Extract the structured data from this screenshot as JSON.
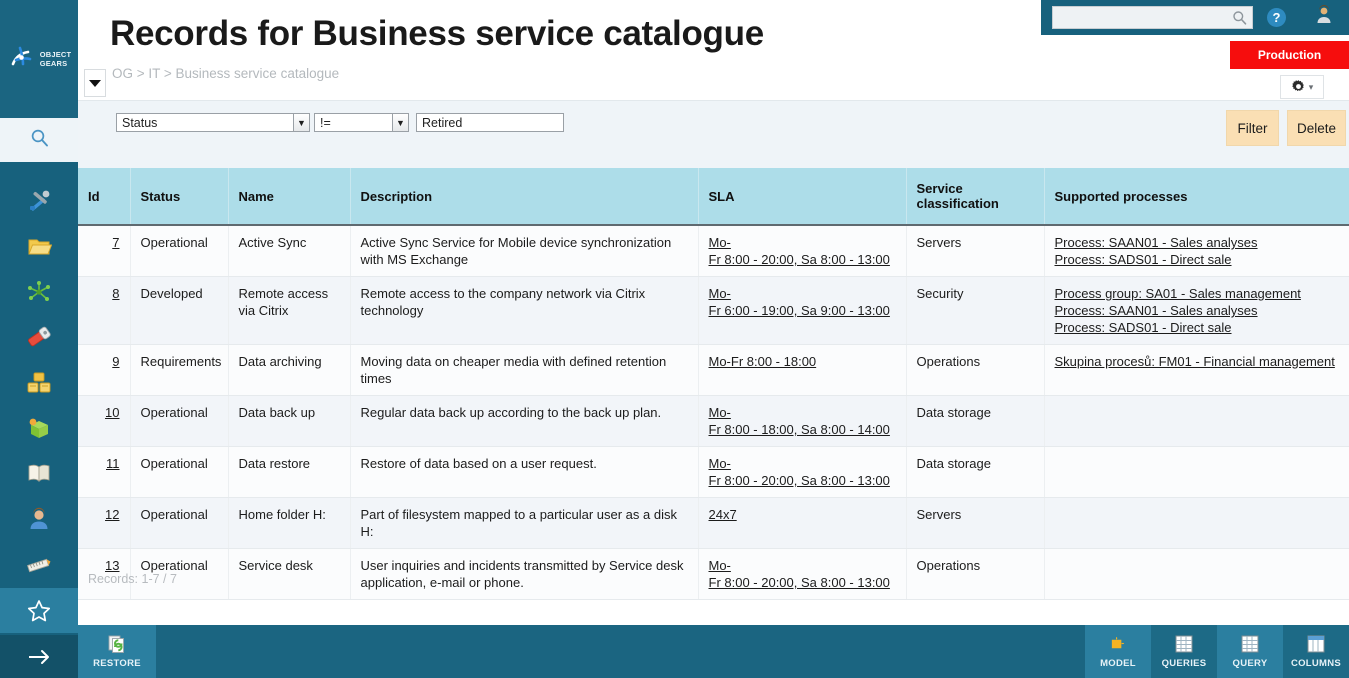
{
  "app": {
    "logo_line1": "OBJECT",
    "logo_line2": "GEARS"
  },
  "header": {
    "title": "Records for Business service catalogue",
    "breadcrumb": "OG > IT > Business service catalogue",
    "env_badge": "Production",
    "search_placeholder": "",
    "search_value": "",
    "accent_color": "#17617d",
    "badge_color": "#f60d0d"
  },
  "sidebar": {
    "search_icon": "search-icon",
    "items": [
      {
        "name": "tools",
        "glyph": "🛠"
      },
      {
        "name": "folder",
        "glyph": "📁"
      },
      {
        "name": "network",
        "glyph": "✵"
      },
      {
        "name": "tag",
        "glyph": "🏷"
      },
      {
        "name": "database",
        "glyph": "🗃"
      },
      {
        "name": "package",
        "glyph": "📦"
      },
      {
        "name": "book",
        "glyph": "📖"
      },
      {
        "name": "user",
        "glyph": "👤"
      },
      {
        "name": "ruler",
        "glyph": "📏"
      },
      {
        "name": "favorites",
        "glyph": "☆"
      },
      {
        "name": "expand",
        "glyph": "→"
      }
    ]
  },
  "filter": {
    "attribute": "Status",
    "operator": "!=",
    "value": "Retired",
    "caret": "⌄",
    "filter_label": "Filter",
    "delete_label": "Delete"
  },
  "table": {
    "columns": [
      "Id",
      "Status",
      "Name",
      "Description",
      "SLA",
      "Service classification",
      "Supported processes"
    ],
    "rows": [
      {
        "id": "7",
        "status": "Operational",
        "name": "Active Sync",
        "description": "Active Sync Service for Mobile device synchronization with MS Exchange",
        "sla": [
          "Mo-",
          "Fr 8:00 - 20:00, Sa 8:00 - 13:00"
        ],
        "classification": "Servers",
        "processes": [
          "Process: SAAN01 - Sales analyses",
          "Process: SADS01 - Direct sale"
        ]
      },
      {
        "id": "8",
        "status": "Developed",
        "name": "Remote access via Citrix",
        "description": "Remote access to the company network via Citrix technology",
        "sla": [
          "Mo-",
          "Fr 6:00 - 19:00, Sa 9:00 - 13:00"
        ],
        "classification": "Security",
        "processes": [
          "Process group: SA01 - Sales management",
          "Process: SAAN01 - Sales analyses",
          "Process: SADS01 - Direct sale"
        ]
      },
      {
        "id": "9",
        "status": "Requirements",
        "name": "Data archiving",
        "description": "Moving data on cheaper media with defined retention times",
        "sla": [
          "Mo-Fr 8:00 - 18:00"
        ],
        "classification": "Operations",
        "processes": [
          "Skupina procesů: FM01 - Financial management"
        ]
      },
      {
        "id": "10",
        "status": "Operational",
        "name": "Data back up",
        "description": "Regular data back up according to the back up plan.",
        "sla": [
          "Mo-",
          "Fr 8:00 - 18:00, Sa 8:00 - 14:00"
        ],
        "classification": "Data storage",
        "processes": []
      },
      {
        "id": "11",
        "status": "Operational",
        "name": "Data restore",
        "description": "Restore of data based on a user request.",
        "sla": [
          "Mo-",
          "Fr 8:00 - 20:00, Sa 8:00 - 13:00"
        ],
        "classification": "Data storage",
        "processes": []
      },
      {
        "id": "12",
        "status": "Operational",
        "name": "Home folder H:",
        "description": "Part of filesystem mapped to a particular user as a disk H:",
        "sla": [
          "24x7"
        ],
        "classification": "Servers",
        "processes": []
      },
      {
        "id": "13",
        "status": "Operational",
        "name": "Service desk",
        "description": "User inquiries and incidents transmitted by Service desk application, e-mail or phone.",
        "sla": [
          "Mo-",
          "Fr 8:00 - 20:00, Sa 8:00 - 13:00"
        ],
        "classification": "Operations",
        "processes": []
      }
    ],
    "records_note": "Records: 1-7 / 7",
    "header_bg": "#addde9"
  },
  "bottombar": {
    "restore": {
      "label": "RESTORE",
      "glyph": "♻"
    },
    "items": [
      {
        "label": "MODEL",
        "glyph": "🧩",
        "dark": false
      },
      {
        "label": "QUERIES",
        "glyph": "▦",
        "dark": true
      },
      {
        "label": "QUERY",
        "glyph": "▦",
        "dark": false
      },
      {
        "label": "COLUMNS",
        "glyph": "▤",
        "dark": true
      }
    ]
  }
}
